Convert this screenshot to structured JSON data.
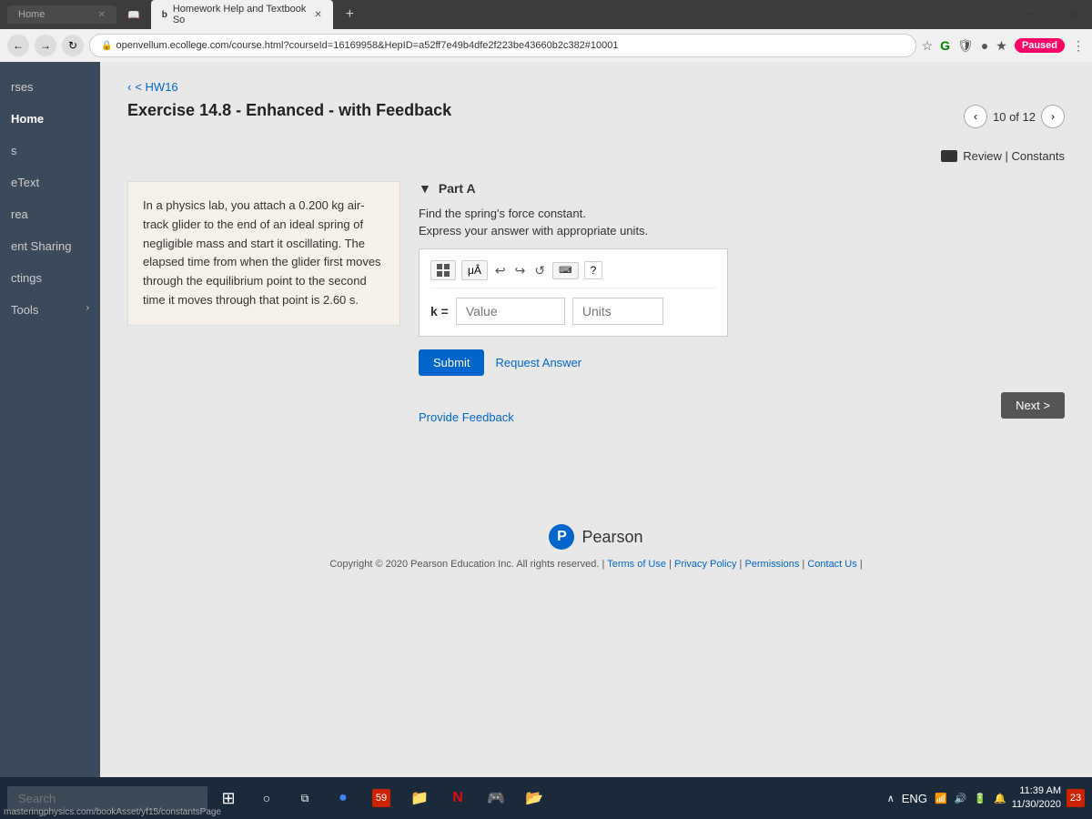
{
  "browser": {
    "tab_inactive_label": "Home",
    "tab_active_label": "Homework Help and Textbook So",
    "address_bar": "openvellum.ecollege.com/course.html?courseId=16169958&HepID=a52ff7e49b4dfe2f223be43660b2c382#10001",
    "paused_label": "Paused"
  },
  "sidebar": {
    "items": [
      {
        "label": "rses"
      },
      {
        "label": "Home"
      },
      {
        "label": "s"
      },
      {
        "label": "eText"
      },
      {
        "label": "rea"
      },
      {
        "label": "ent Sharing"
      },
      {
        "label": "ctings"
      },
      {
        "label": "Tools"
      }
    ]
  },
  "page": {
    "back_label": "< HW16",
    "exercise_title": "Exercise 14.8 - Enhanced - with Feedback",
    "nav_counter": "10 of 12",
    "review_label": "Review | Constants",
    "problem_text": "In a physics lab, you attach a 0.200 kg air-track glider to the end of an ideal spring of negligible mass and start it oscillating. The elapsed time from when the glider first moves through the equilibrium point to the second time it moves through that point is 2.60 s.",
    "part_label": "Part A",
    "instruction1": "Find the spring's force constant.",
    "instruction2": "Express your answer with appropriate units.",
    "k_label": "k =",
    "value_placeholder": "Value",
    "units_placeholder": "Units",
    "submit_label": "Submit",
    "request_answer_label": "Request Answer",
    "provide_feedback_label": "Provide Feedback",
    "next_label": "Next >"
  },
  "footer": {
    "pearson_name": "Pearson",
    "copyright_text": "Copyright © 2020 Pearson Education Inc. All rights reserved.",
    "terms_label": "Terms of Use",
    "privacy_label": "Privacy Policy",
    "permissions_label": "Permissions",
    "contact_label": "Contact Us"
  },
  "taskbar": {
    "search_placeholder": "Search",
    "time": "11:39 AM",
    "date": "11/30/2020",
    "notification_count": "23",
    "status_bar_url": "masteringphysics.com/bookAsset/yf15/constantsPage"
  }
}
